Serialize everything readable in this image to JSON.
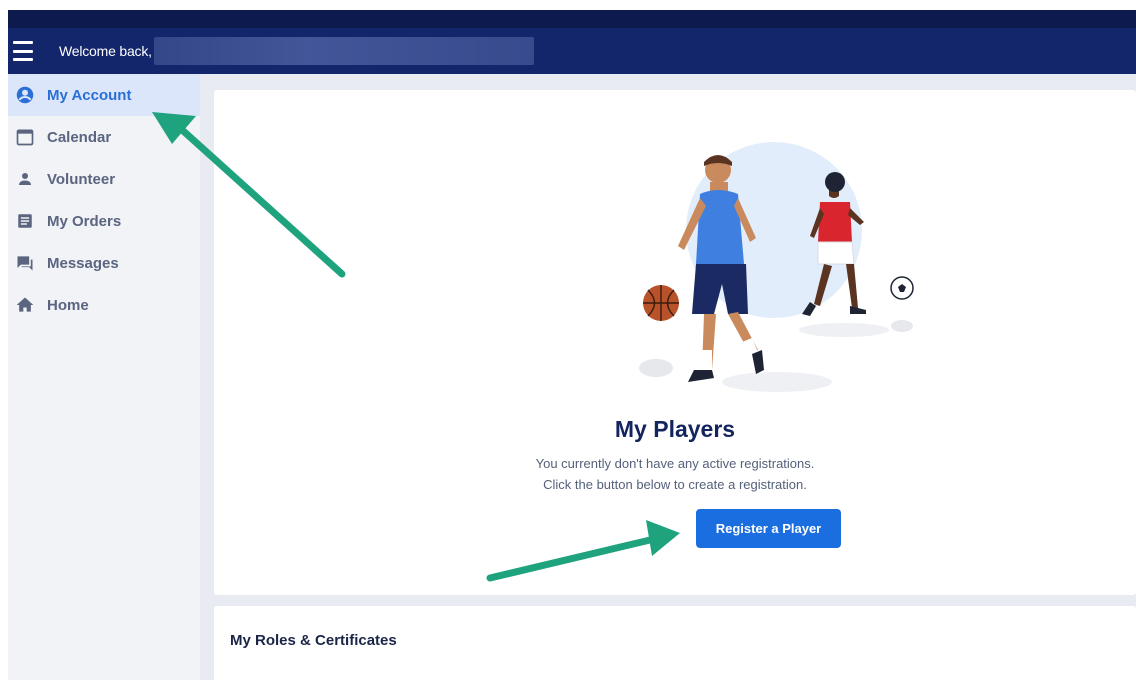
{
  "header": {
    "welcome_text": "Welcome back,"
  },
  "sidebar": {
    "items": [
      {
        "label": "My Account",
        "icon": "account-circle-icon",
        "active": true
      },
      {
        "label": "Calendar",
        "icon": "calendar-icon",
        "active": false
      },
      {
        "label": "Volunteer",
        "icon": "person-icon",
        "active": false
      },
      {
        "label": "My Orders",
        "icon": "orders-icon",
        "active": false
      },
      {
        "label": "Messages",
        "icon": "messages-icon",
        "active": false
      },
      {
        "label": "Home",
        "icon": "home-icon",
        "active": false
      }
    ]
  },
  "players": {
    "title": "My Players",
    "description_line1": "You currently don't have any active registrations.",
    "description_line2": "Click the button below to create a registration.",
    "register_button": "Register a Player"
  },
  "roles": {
    "title": "My Roles & Certificates"
  },
  "colors": {
    "header": "#13266b",
    "accent": "#1b6ee0",
    "annotation_arrow": "#1fa37e"
  }
}
